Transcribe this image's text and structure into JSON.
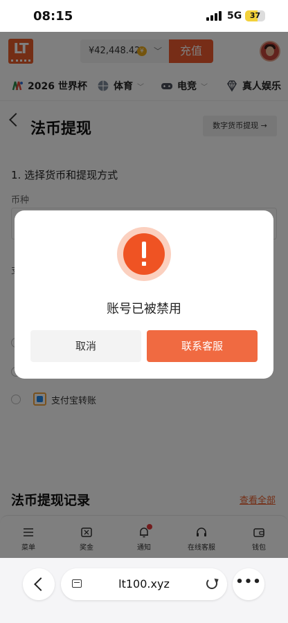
{
  "status_bar": {
    "time": "08:15",
    "network": "5G",
    "battery": "37"
  },
  "header": {
    "logo_text": "LT",
    "balance": "¥42,448.42",
    "recharge_label": "充值"
  },
  "nav": {
    "items": [
      {
        "label": "2026 世界杯",
        "has_dropdown": false
      },
      {
        "label": "体育",
        "has_dropdown": true
      },
      {
        "label": "电竞",
        "has_dropdown": true
      },
      {
        "label": "真人娱乐",
        "has_dropdown": false
      }
    ]
  },
  "page": {
    "title": "法币提现",
    "crypto_button": "数字货币提现 →",
    "section_title": "1. 选择货币和提现方式",
    "currency_label": "币种",
    "method_label": "支",
    "methods": [
      {
        "name": ""
      },
      {
        "name": ""
      },
      {
        "name": "支付宝转账"
      }
    ],
    "records_title": "法币提现记录",
    "view_all": "查看全部"
  },
  "bottom_nav": {
    "items": [
      {
        "label": "菜单",
        "icon": "menu-icon"
      },
      {
        "label": "奖金",
        "icon": "ticket-icon"
      },
      {
        "label": "通知",
        "icon": "bell-icon"
      },
      {
        "label": "在线客服",
        "icon": "headset-icon"
      },
      {
        "label": "钱包",
        "icon": "wallet-icon"
      }
    ]
  },
  "browser": {
    "url": "lt100.xyz"
  },
  "dialog": {
    "message": "账号已被禁用",
    "cancel_label": "取消",
    "contact_label": "联系客服",
    "icon": "alert-icon"
  },
  "colors": {
    "accent": "#ee5a2e",
    "alert": "#ef5323",
    "contact_button": "#f06a41",
    "overlay": "rgba(0,0,0,0.5)"
  }
}
